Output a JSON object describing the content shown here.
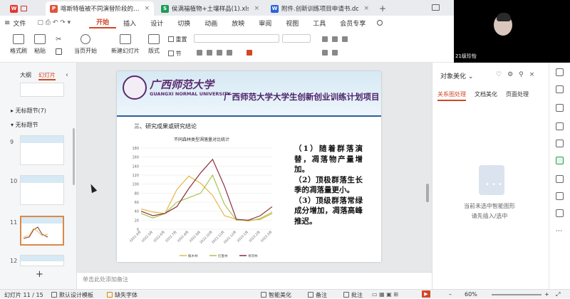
{
  "tabs": [
    {
      "label": "",
      "icon": "wps-logo-icon",
      "color": "#e0382f"
    },
    {
      "label": "喀斯特植被不同演替阶段的…",
      "icon": "ppt-file-icon",
      "color": "#e0553a"
    },
    {
      "label": "侯满福植物+土壤样品(1).xlsx",
      "icon": "xlsx-file-icon",
      "color": "#1e9b5a"
    },
    {
      "label": "附件.创新训练项目申请书.doc",
      "icon": "doc-file-icon",
      "color": "#2c62d9"
    }
  ],
  "menu": {
    "file": "文件",
    "items": [
      "开始",
      "插入",
      "设计",
      "切换",
      "动画",
      "放映",
      "审阅",
      "视图",
      "工具",
      "会员专享"
    ],
    "active": "开始"
  },
  "ribbon": {
    "format_painter": "格式刷",
    "paste": "粘贴",
    "play_current": "当页开始",
    "new_slide": "新建幻灯片",
    "layout": "版式",
    "section": "节",
    "reset": "重置"
  },
  "video": {
    "name": "21级珍怡"
  },
  "left_panel": {
    "tabs": [
      "大纲",
      "幻灯片"
    ],
    "active_tab": "幻灯片",
    "sections": [
      {
        "label": "无标题节(7)"
      },
      {
        "label": "无标题节"
      }
    ],
    "slide_numbers": [
      "9",
      "10",
      "11",
      "12"
    ],
    "add_slide": "+"
  },
  "slide": {
    "school_name_cn": "广西师范大学",
    "school_name_en": "GUANGXI NORMAL UNIVERSITY",
    "project_title": "广西师范大学大学生创新创业训练计划项目",
    "section_heading": "三、研究成果或研究结论",
    "conclusions": [
      "（1）随着群落演替，凋落物产量增加。",
      "（2）顶极群落生长季的凋落量更小。",
      "（3）顶级群落常绿成分增加，凋落高峰推迟。"
    ]
  },
  "chart_data": {
    "type": "line",
    "title": "不同森林类型凋落量对比统计",
    "categories": [
      "2022.4月",
      "2022.5月",
      "2022.6月",
      "2022.7月",
      "2022.8月",
      "2022.9月",
      "2022.10月",
      "2022.11月",
      "2022.12月",
      "2023.1月",
      "2023.2月",
      "2023.3月"
    ],
    "ylim": [
      0,
      180
    ],
    "yticks": [
      0,
      20,
      40,
      60,
      80,
      100,
      120,
      140,
      160,
      180
    ],
    "series": [
      {
        "name": "檵木林",
        "color": "#e6b84a",
        "values": [
          45,
          38,
          35,
          88,
          118,
          102,
          75,
          30,
          22,
          18,
          24,
          38
        ]
      },
      {
        "name": "红锥林",
        "color": "#a8c44e",
        "values": [
          35,
          25,
          35,
          60,
          70,
          80,
          120,
          55,
          20,
          20,
          22,
          35
        ]
      },
      {
        "name": "青冈林",
        "color": "#8b2f3a",
        "values": [
          40,
          30,
          35,
          50,
          90,
          125,
          155,
          95,
          22,
          20,
          30,
          50
        ]
      }
    ]
  },
  "notes": {
    "placeholder": "单击此处添加备注"
  },
  "right_panel": {
    "title": "对象美化",
    "tabs": [
      "关系图处理",
      "文档美化",
      "页面处理"
    ],
    "active_tab": "关系图处理",
    "empty_hint_1": "当前未选中智能图形",
    "empty_hint_2": "请先插入/选中"
  },
  "status": {
    "slide_position": "幻灯片 11 / 15",
    "design_template": "默认设计模板",
    "missing_font": "缺失字体",
    "smart_beautify": "智能美化",
    "notes_btn": "备注",
    "comments_btn": "批注",
    "zoom": "60%"
  }
}
